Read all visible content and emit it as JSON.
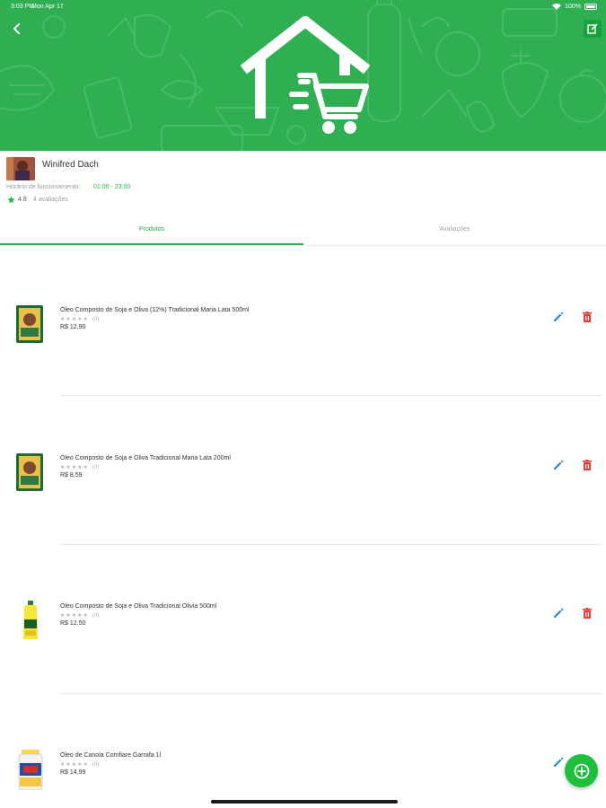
{
  "status_bar": {
    "time": "3:03 PM",
    "date": "Mon Apr 17",
    "battery": "100%"
  },
  "header": {
    "background_color": "#2fae52",
    "back_icon": "chevron-left-icon",
    "edit_icon": "edit-square-icon",
    "logo_icon": "house-cart-icon"
  },
  "store": {
    "name": "Winifred Dach",
    "hours_label": "Horário de funcionamento:",
    "hours_value": "01:00 - 23:00",
    "rating": "4.8",
    "reviews": "4 avaliações"
  },
  "tabs": [
    {
      "label": "Produtos",
      "active": true
    },
    {
      "label": "Avaliações",
      "active": false
    }
  ],
  "products": [
    {
      "name": "Óleo Composto de Soja e Oliva (12%) Tradicional Maria Lata 500ml",
      "stars": "★★★★★",
      "reviews": "(0)",
      "price": "R$ 12,90",
      "image": "can"
    },
    {
      "name": "Óleo Composto de Soja e Oliva Tradicional Maria Lata 200ml",
      "stars": "★★★★★",
      "reviews": "(0)",
      "price": "R$ 8,59",
      "image": "can"
    },
    {
      "name": "Óleo Composto de Soja e Oliva Tradicional Olivia 500ml",
      "stars": "★★★★★",
      "reviews": "(0)",
      "price": "R$ 12,50",
      "image": "bottle"
    },
    {
      "name": "Óleo de Canola Comfiare Garrafa 1l",
      "stars": "★★★★★",
      "reviews": "(0)",
      "price": "R$ 14,99",
      "image": "jar"
    }
  ],
  "colors": {
    "accent": "#2bb24d",
    "edit": "#1e88e5",
    "delete": "#e53935",
    "fab": "#1dbf3c"
  },
  "fab": {
    "icon": "add-circle-icon"
  }
}
